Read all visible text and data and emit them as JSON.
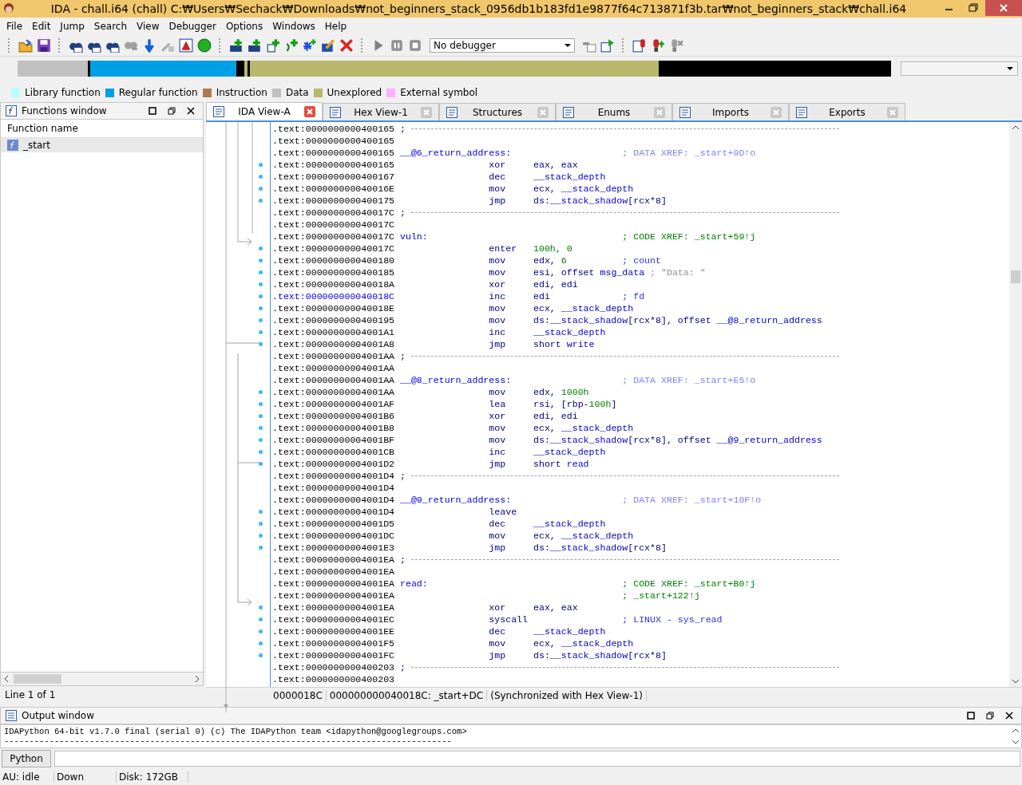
{
  "window": {
    "title": "IDA - chall.i64 (chall) C:₩Users₩Sechack₩Downloads₩not_beginners_stack_0956db1b183fd1e9877f64c713871f3b.tar₩not_beginners_stack₩chall.i64"
  },
  "menu": [
    "File",
    "Edit",
    "Jump",
    "Search",
    "View",
    "Debugger",
    "Options",
    "Windows",
    "Help"
  ],
  "debugger_select": {
    "value": "No debugger"
  },
  "legend": [
    {
      "label": "Library function",
      "color": "#b4ffff"
    },
    {
      "label": "Regular function",
      "color": "#00a0e6"
    },
    {
      "label": "Instruction",
      "color": "#b07850"
    },
    {
      "label": "Data",
      "color": "#c0c0c0"
    },
    {
      "label": "Unexplored",
      "color": "#b8b86c"
    },
    {
      "label": "External symbol",
      "color": "#ffb0ff"
    }
  ],
  "functions_window": {
    "title": "Functions window",
    "column": "Function name",
    "items": [
      {
        "name": "_start",
        "selected": true
      }
    ],
    "status": "Line 1 of 1"
  },
  "tabs": [
    {
      "label": "IDA View-A",
      "selected": true
    },
    {
      "label": "Hex View-1",
      "selected": false
    },
    {
      "label": "Structures",
      "selected": false
    },
    {
      "label": "Enums",
      "selected": false
    },
    {
      "label": "Imports",
      "selected": false
    },
    {
      "label": "Exports",
      "selected": false
    }
  ],
  "listing": [
    {
      "address": ".text:0000000000400165",
      "kind": "sep",
      "comment": ";",
      "selected": false
    },
    {
      "address": ".text:0000000000400165",
      "kind": "blank",
      "selected": false
    },
    {
      "address": ".text:0000000000400165",
      "kind": "label",
      "label": "__@6_return_address:",
      "comment": "; DATA XREF: _start+9D↑o",
      "color": "#8080ff",
      "selected": false
    },
    {
      "address": ".text:0000000000400165",
      "kind": "insn",
      "mnemonic": "xor",
      "operands": [
        {
          "text": "eax, eax",
          "kind": "reg"
        }
      ],
      "selected": false
    },
    {
      "address": ".text:0000000000400167",
      "kind": "insn",
      "mnemonic": "dec",
      "operands": [
        {
          "text": "__stack_depth",
          "kind": "name"
        }
      ],
      "selected": false
    },
    {
      "address": ".text:000000000040016E",
      "kind": "insn",
      "mnemonic": "mov",
      "operands": [
        {
          "text": "ecx, ",
          "kind": "reg"
        },
        {
          "text": "__stack_depth",
          "kind": "name"
        }
      ],
      "selected": false
    },
    {
      "address": ".text:0000000000400175",
      "kind": "insn",
      "mnemonic": "jmp",
      "operands": [
        {
          "text": "ds:",
          "kind": "reg"
        },
        {
          "text": "__stack_shadow",
          "kind": "name"
        },
        {
          "text": "[rcx*8]",
          "kind": "reg"
        }
      ],
      "selected": false
    },
    {
      "address": ".text:000000000040017C",
      "kind": "sep",
      "comment": ";",
      "selected": false
    },
    {
      "address": ".text:000000000040017C",
      "kind": "blank",
      "selected": false
    },
    {
      "address": ".text:000000000040017C",
      "kind": "label",
      "label": "vuln:",
      "comment": "; CODE XREF: _start+59↑j",
      "color": "#008000",
      "selected": false
    },
    {
      "address": ".text:000000000040017C",
      "kind": "insn",
      "mnemonic": "enter",
      "operands": [
        {
          "text": "100h, 0",
          "kind": "num"
        }
      ],
      "selected": false
    },
    {
      "address": ".text:0000000000400180",
      "kind": "insn",
      "mnemonic": "mov",
      "operands": [
        {
          "text": "edx, ",
          "kind": "reg"
        },
        {
          "text": "6",
          "kind": "num"
        }
      ],
      "comment": "; count",
      "color": "#3030e0",
      "selected": false
    },
    {
      "address": ".text:0000000000400185",
      "kind": "insn",
      "mnemonic": "mov",
      "operands": [
        {
          "text": "esi, offset ",
          "kind": "reg"
        },
        {
          "text": "msg_data",
          "kind": "name"
        }
      ],
      "comment": "; \"Data: \"",
      "color": "#909090",
      "selected": false
    },
    {
      "address": ".text:000000000040018A",
      "kind": "insn",
      "mnemonic": "xor",
      "operands": [
        {
          "text": "edi, edi",
          "kind": "reg"
        }
      ],
      "selected": false
    },
    {
      "address": ".text:000000000040018C",
      "kind": "insn",
      "mnemonic": "inc",
      "operands": [
        {
          "text": "edi",
          "kind": "reg"
        }
      ],
      "comment": "; fd",
      "color": "#3030e0",
      "selected": true
    },
    {
      "address": ".text:000000000040018E",
      "kind": "insn",
      "mnemonic": "mov",
      "operands": [
        {
          "text": "ecx, ",
          "kind": "reg"
        },
        {
          "text": "__stack_depth",
          "kind": "name"
        }
      ],
      "selected": false
    },
    {
      "address": ".text:0000000000400195",
      "kind": "insn",
      "mnemonic": "mov",
      "operands": [
        {
          "text": "ds:",
          "kind": "reg"
        },
        {
          "text": "__stack_shadow",
          "kind": "name"
        },
        {
          "text": "[rcx*8], offset ",
          "kind": "reg"
        },
        {
          "text": "__@8_return_address",
          "kind": "name"
        }
      ],
      "selected": false
    },
    {
      "address": ".text:00000000004001A1",
      "kind": "insn",
      "mnemonic": "inc",
      "operands": [
        {
          "text": "__stack_depth",
          "kind": "name"
        }
      ],
      "selected": false
    },
    {
      "address": ".text:00000000004001A8",
      "kind": "insn",
      "mnemonic": "jmp",
      "operands": [
        {
          "text": "short ",
          "kind": "reg"
        },
        {
          "text": "write",
          "kind": "name"
        }
      ],
      "selected": false
    },
    {
      "address": ".text:00000000004001AA",
      "kind": "sep",
      "comment": ";",
      "selected": false
    },
    {
      "address": ".text:00000000004001AA",
      "kind": "blank",
      "selected": false
    },
    {
      "address": ".text:00000000004001AA",
      "kind": "label",
      "label": "__@8_return_address:",
      "comment": "; DATA XREF: _start+E5↑o",
      "color": "#8080ff",
      "selected": false
    },
    {
      "address": ".text:00000000004001AA",
      "kind": "insn",
      "mnemonic": "mov",
      "operands": [
        {
          "text": "edx, ",
          "kind": "reg"
        },
        {
          "text": "1000h",
          "kind": "num"
        }
      ],
      "selected": false
    },
    {
      "address": ".text:00000000004001AF",
      "kind": "insn",
      "mnemonic": "lea",
      "operands": [
        {
          "text": "rsi, [rbp-",
          "kind": "reg"
        },
        {
          "text": "100h",
          "kind": "num"
        },
        {
          "text": "]",
          "kind": "reg"
        }
      ],
      "selected": false
    },
    {
      "address": ".text:00000000004001B6",
      "kind": "insn",
      "mnemonic": "xor",
      "operands": [
        {
          "text": "edi, edi",
          "kind": "reg"
        }
      ],
      "selected": false
    },
    {
      "address": ".text:00000000004001B8",
      "kind": "insn",
      "mnemonic": "mov",
      "operands": [
        {
          "text": "ecx, ",
          "kind": "reg"
        },
        {
          "text": "__stack_depth",
          "kind": "name"
        }
      ],
      "selected": false
    },
    {
      "address": ".text:00000000004001BF",
      "kind": "insn",
      "mnemonic": "mov",
      "operands": [
        {
          "text": "ds:",
          "kind": "reg"
        },
        {
          "text": "__stack_shadow",
          "kind": "name"
        },
        {
          "text": "[rcx*8], offset ",
          "kind": "reg"
        },
        {
          "text": "__@9_return_address",
          "kind": "name"
        }
      ],
      "selected": false
    },
    {
      "address": ".text:00000000004001CB",
      "kind": "insn",
      "mnemonic": "inc",
      "operands": [
        {
          "text": "__stack_depth",
          "kind": "name"
        }
      ],
      "selected": false
    },
    {
      "address": ".text:00000000004001D2",
      "kind": "insn",
      "mnemonic": "jmp",
      "operands": [
        {
          "text": "short ",
          "kind": "reg"
        },
        {
          "text": "read",
          "kind": "name"
        }
      ],
      "selected": false
    },
    {
      "address": ".text:00000000004001D4",
      "kind": "sep",
      "comment": ";",
      "selected": false
    },
    {
      "address": ".text:00000000004001D4",
      "kind": "blank",
      "selected": false
    },
    {
      "address": ".text:00000000004001D4",
      "kind": "label",
      "label": "__@9_return_address:",
      "comment": "; DATA XREF: _start+10F↑o",
      "color": "#8080ff",
      "selected": false
    },
    {
      "address": ".text:00000000004001D4",
      "kind": "insn",
      "mnemonic": "leave",
      "selected": false
    },
    {
      "address": ".text:00000000004001D5",
      "kind": "insn",
      "mnemonic": "dec",
      "operands": [
        {
          "text": "__stack_depth",
          "kind": "name"
        }
      ],
      "selected": false
    },
    {
      "address": ".text:00000000004001DC",
      "kind": "insn",
      "mnemonic": "mov",
      "operands": [
        {
          "text": "ecx, ",
          "kind": "reg"
        },
        {
          "text": "__stack_depth",
          "kind": "name"
        }
      ],
      "selected": false
    },
    {
      "address": ".text:00000000004001E3",
      "kind": "insn",
      "mnemonic": "jmp",
      "operands": [
        {
          "text": "ds:",
          "kind": "reg"
        },
        {
          "text": "__stack_shadow",
          "kind": "name"
        },
        {
          "text": "[rcx*8]",
          "kind": "reg"
        }
      ],
      "selected": false
    },
    {
      "address": ".text:00000000004001EA",
      "kind": "sep",
      "comment": ";",
      "selected": false
    },
    {
      "address": ".text:00000000004001EA",
      "kind": "blank",
      "selected": false
    },
    {
      "address": ".text:00000000004001EA",
      "kind": "label",
      "label": "read:",
      "comment": "; CODE XREF: _start+B0↑j",
      "color": "#008000",
      "selected": false
    },
    {
      "address": ".text:00000000004001EA",
      "kind": "label",
      "comment": "; _start+122↑j",
      "color": "#008000",
      "selected": false
    },
    {
      "address": ".text:00000000004001EA",
      "kind": "insn",
      "mnemonic": "xor",
      "operands": [
        {
          "text": "eax, eax",
          "kind": "reg"
        }
      ],
      "selected": false
    },
    {
      "address": ".text:00000000004001EC",
      "kind": "insn",
      "mnemonic": "syscall",
      "comment": "; LINUX - sys_read",
      "color": "#3030e0",
      "selected": false
    },
    {
      "address": ".text:00000000004001EE",
      "kind": "insn",
      "mnemonic": "dec",
      "operands": [
        {
          "text": "__stack_depth",
          "kind": "name"
        }
      ],
      "selected": false
    },
    {
      "address": ".text:00000000004001F5",
      "kind": "insn",
      "mnemonic": "mov",
      "operands": [
        {
          "text": "ecx, ",
          "kind": "reg"
        },
        {
          "text": "__stack_depth",
          "kind": "name"
        }
      ],
      "selected": false
    },
    {
      "address": ".text:00000000004001FC",
      "kind": "insn",
      "mnemonic": "jmp",
      "operands": [
        {
          "text": "ds:",
          "kind": "reg"
        },
        {
          "text": "__stack_shadow",
          "kind": "name"
        },
        {
          "text": "[rcx*8]",
          "kind": "reg"
        }
      ],
      "selected": false
    },
    {
      "address": ".text:0000000000400203",
      "kind": "sep",
      "comment": ";",
      "selected": false
    },
    {
      "address": ".text:0000000000400203",
      "kind": "blank",
      "selected": false
    }
  ],
  "listing_status": [
    "0000018C",
    "000000000040018C: _start+DC",
    "(Synchronized with Hex View-1)"
  ],
  "output_window": {
    "title": "Output window",
    "lines": [
      "IDAPython 64-bit v1.7.0 final (serial 0) (c) The IDAPython team <idapython@googlegroups.com>",
      "-----------------------------------------------------------------------------------------"
    ],
    "button": "Python"
  },
  "status_bar": [
    "AU:  idle",
    "Down",
    "Disk: 172GB"
  ]
}
